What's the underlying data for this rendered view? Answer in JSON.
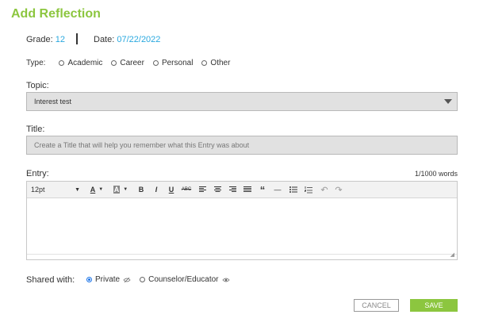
{
  "page": {
    "title": "Add Reflection"
  },
  "meta": {
    "grade_label": "Grade:",
    "grade_value": "12",
    "date_label": "Date:",
    "date_value": "07/22/2022"
  },
  "type": {
    "label": "Type:",
    "options": [
      "Academic",
      "Career",
      "Personal",
      "Other"
    ],
    "selected": ""
  },
  "topic": {
    "label": "Topic:",
    "value": "Interest test"
  },
  "title_field": {
    "label": "Title:",
    "placeholder": "Create a Title that will help you remember what this Entry was about"
  },
  "entry": {
    "label": "Entry:",
    "word_count": "1/1000 words",
    "toolbar": {
      "font_size": "12pt",
      "text_color_glyph": "A",
      "bg_color_glyph": "A",
      "bold": "B",
      "italic": "I",
      "underline": "U",
      "strike": "ABC",
      "quote": "“",
      "hr": "—",
      "undo": "↶",
      "redo": "↷"
    }
  },
  "shared": {
    "label": "Shared with:",
    "options": [
      "Private",
      "Counselor/Educator"
    ],
    "selected": "Private"
  },
  "buttons": {
    "cancel": "CANCEL",
    "save": "SAVE"
  },
  "colors": {
    "brand_green": "#8cc63f",
    "link_blue": "#29a8df",
    "radio_blue": "#1a73e8"
  },
  "icons": [
    "caret-down-icon",
    "align-left-icon",
    "align-center-icon",
    "align-right-icon",
    "justify-icon",
    "bullet-list-icon",
    "numbered-list-icon",
    "eye-slash-icon",
    "eye-icon",
    "resize-handle-icon"
  ]
}
